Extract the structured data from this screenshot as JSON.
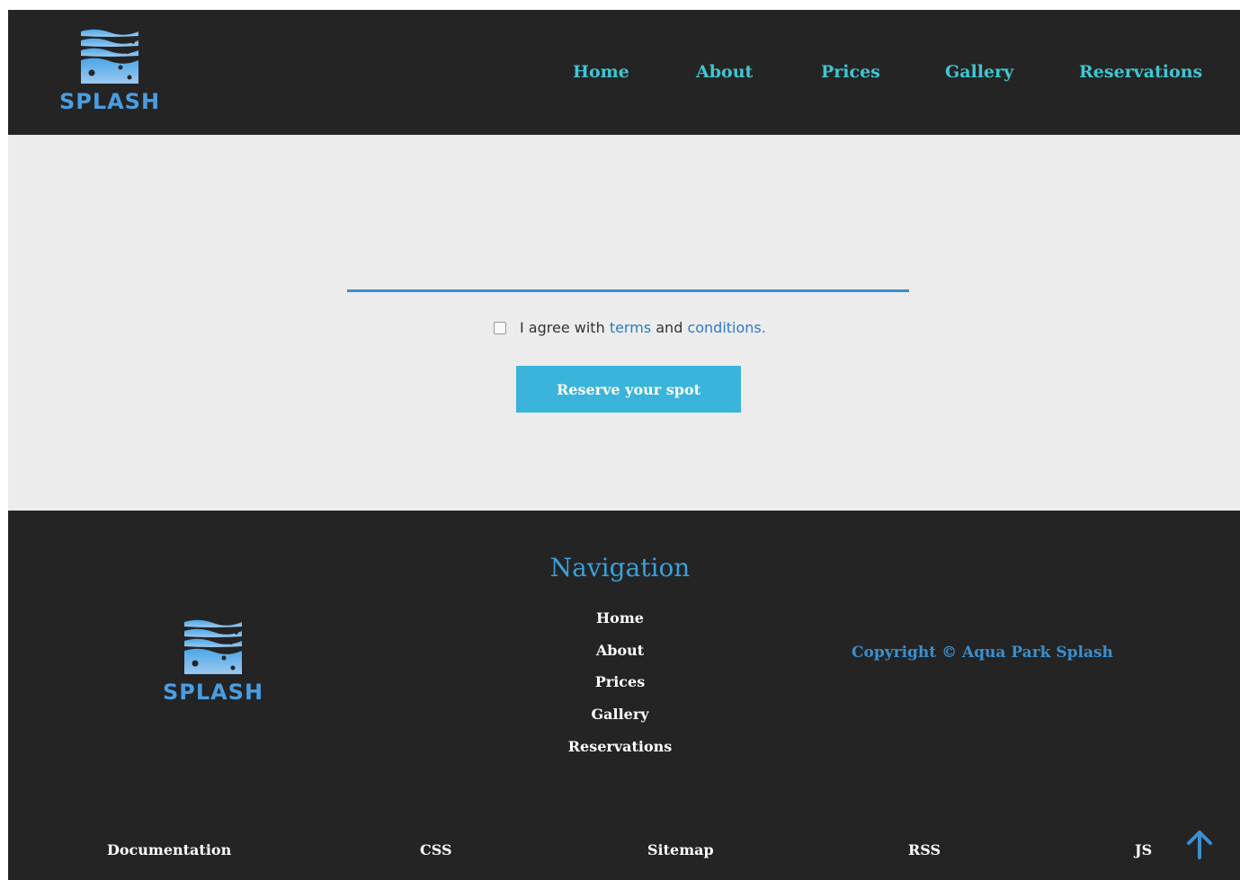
{
  "header": {
    "logo_text": "SPLASH",
    "nav": [
      "Home",
      "About",
      "Prices",
      "Gallery",
      "Reservations"
    ]
  },
  "form": {
    "agree_prefix": "I agree with",
    "terms_link": "terms",
    "and_text": "and",
    "conditions_link": "conditions.",
    "reserve_label": "Reserve your spot"
  },
  "footer": {
    "logo_text": "SPLASH",
    "nav_title": "Navigation",
    "nav_items": [
      "Home",
      "About",
      "Prices",
      "Gallery",
      "Reservations"
    ],
    "copyright": "Copyright © Aqua Park Splash",
    "bottom_links": [
      "Documentation",
      "CSS",
      "Sitemap",
      "RSS",
      "JS"
    ]
  },
  "icons": {
    "logo": "splash-wave-logo-icon",
    "back_to_top": "arrow-up-icon"
  },
  "colors": {
    "dark_bg": "#242424",
    "nav_link": "#3fc6d2",
    "accent_blue": "#3a8fd0",
    "button": "#3ab4da",
    "content_bg": "#ececec"
  }
}
